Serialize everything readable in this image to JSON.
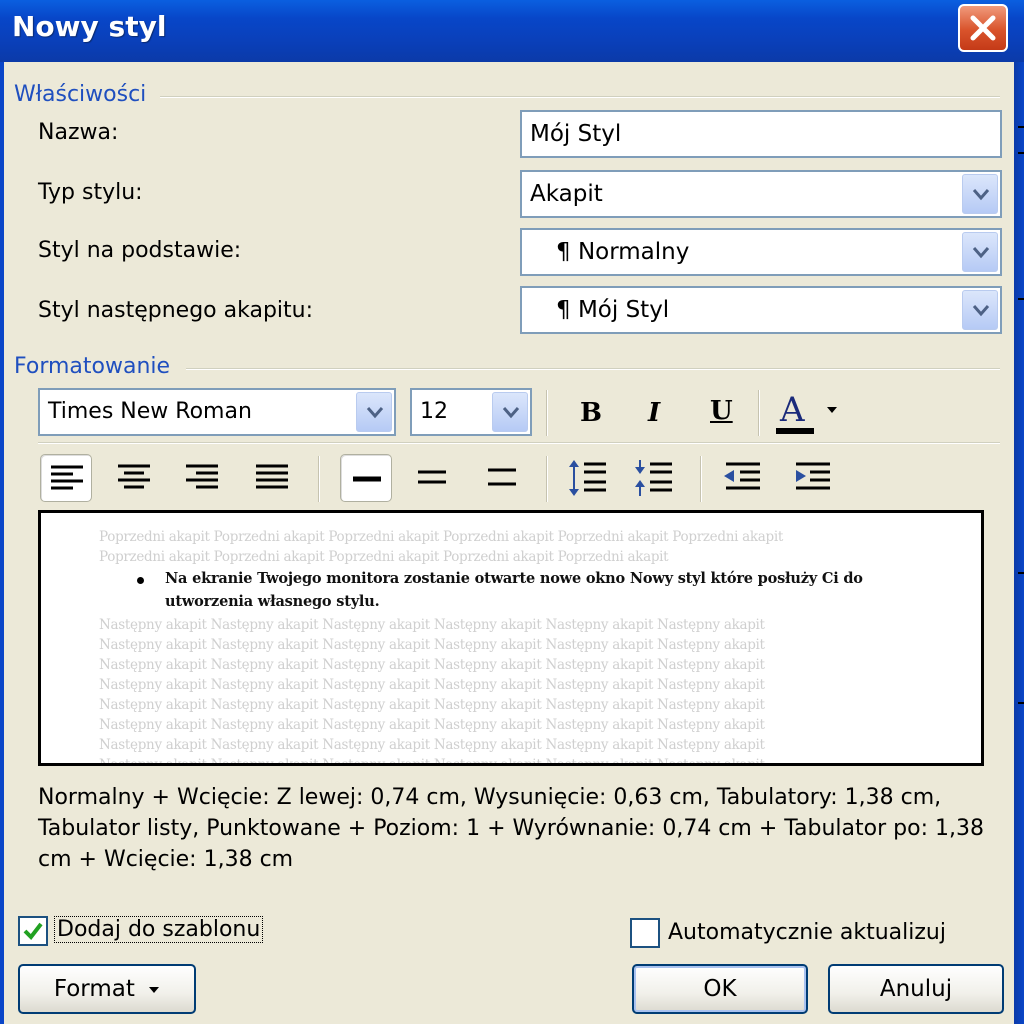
{
  "window": {
    "title": "Nowy styl"
  },
  "properties": {
    "legend": "Właściwości",
    "name": {
      "label": "Nazwa:",
      "value": "Mój Styl"
    },
    "style_type": {
      "label": "Typ stylu:",
      "value": "Akapit"
    },
    "based_on": {
      "label": "Styl na podstawie:",
      "value": "Normalny"
    },
    "next_style": {
      "label": "Styl następnego akapitu:",
      "value": "Mój Styl"
    },
    "paragraph_mark": "¶"
  },
  "formatting": {
    "legend": "Formatowanie",
    "font": "Times New Roman",
    "size": "12",
    "bold": "B",
    "italic": "I",
    "underline": "U",
    "font_color_glyph": "A",
    "font_color": "#000000"
  },
  "preview": {
    "prev_lines": [
      "Poprzedni akapit Poprzedni akapit Poprzedni akapit Poprzedni akapit Poprzedni akapit Poprzedni akapit",
      "Poprzedni akapit Poprzedni akapit Poprzedni akapit Poprzedni akapit Poprzedni akapit"
    ],
    "bullet_lines": [
      "Na ekranie Twojego monitora zostanie otwarte nowe okno Nowy styl które posłuży Ci do",
      "utworzenia własnego stylu."
    ],
    "next_lines": [
      "Następny akapit Następny akapit Następny akapit Następny akapit Następny akapit Następny akapit",
      "Następny akapit Następny akapit Następny akapit Następny akapit Następny akapit Następny akapit",
      "Następny akapit Następny akapit Następny akapit Następny akapit Następny akapit Następny akapit",
      "Następny akapit Następny akapit Następny akapit Następny akapit Następny akapit Następny akapit",
      "Następny akapit Następny akapit Następny akapit Następny akapit Następny akapit Następny akapit",
      "Następny akapit Następny akapit Następny akapit Następny akapit Następny akapit Następny akapit",
      "Następny akapit Następny akapit Następny akapit Następny akapit Następny akapit Następny akapit",
      "Następny akapit Następny akapit Następny akapit Następny akapit Następny akapit Następny akapit"
    ]
  },
  "description": "Normalny + Wcięcie: Z lewej:  0,74 cm, Wysunięcie:  0,63 cm, Tabulatory:  1,38 cm, Tabulator listy, Punktowane + Poziom: 1 + Wyrównanie:  0,74 cm + Tabulator po:  1,38 cm + Wcięcie:  1,38 cm",
  "options": {
    "add_to_template": {
      "label": "Dodaj do szablonu",
      "checked": true
    },
    "auto_update": {
      "label": "Automatycznie aktualizuj",
      "checked": false
    }
  },
  "buttons": {
    "format": "Format",
    "ok": "OK",
    "cancel": "Anuluj"
  }
}
